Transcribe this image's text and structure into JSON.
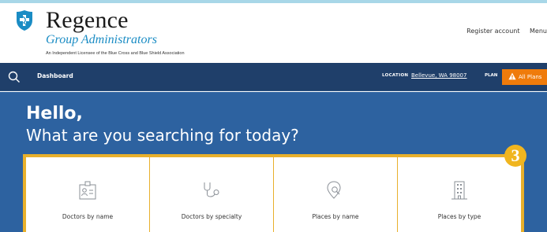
{
  "brand": {
    "name": "Regence",
    "subname": "Group Administrators",
    "license": "An Independent Licensee of the Blue Cross and Blue Shield Association"
  },
  "header": {
    "register_label": "Register account",
    "menu_label": "Menu"
  },
  "nav": {
    "dashboard_label": "Dashboard",
    "location_label": "LOCATION",
    "location_value": "Bellevue, WA 98007",
    "plan_label": "PLAN",
    "plans_button_label": "All Plans",
    "search_icon": "search-icon",
    "warning_icon": "warning-icon"
  },
  "hero": {
    "greeting": "Hello,",
    "question": "What are you searching for today?",
    "step_number": "3"
  },
  "cards": [
    {
      "label": "Doctors by name",
      "icon": "id-badge-icon"
    },
    {
      "label": "Doctors by specialty",
      "icon": "stethoscope-icon"
    },
    {
      "label": "Places by name",
      "icon": "location-search-icon"
    },
    {
      "label": "Places by type",
      "icon": "building-icon"
    }
  ],
  "colors": {
    "navbar": "#1f3f6a",
    "hero": "#2d62a0",
    "accent_orange": "#ef7b0b",
    "highlight_gold": "#e8b02c",
    "brand_blue": "#1a8cc4"
  }
}
